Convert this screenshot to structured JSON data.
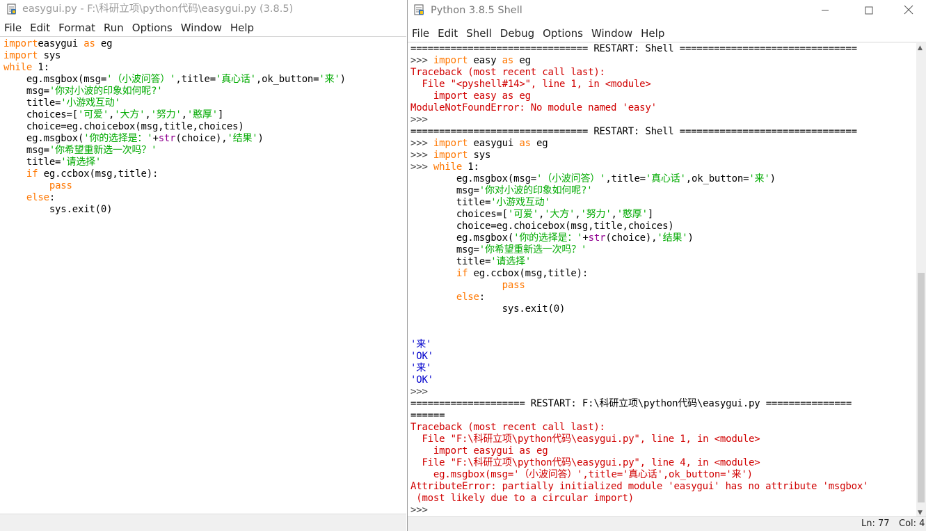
{
  "editor": {
    "title": "easygui.py - F:\\科研立项\\python代码\\easygui.py (3.8.5)",
    "menu": [
      "File",
      "Edit",
      "Format",
      "Run",
      "Options",
      "Window",
      "Help"
    ]
  },
  "shell": {
    "title": "Python 3.8.5 Shell",
    "menu": [
      "File",
      "Edit",
      "Shell",
      "Debug",
      "Options",
      "Window",
      "Help"
    ],
    "status": {
      "line": "Ln: 77",
      "col": "Col: 4"
    }
  },
  "colors": {
    "keyword": "#ff7700",
    "string": "#00aa00",
    "builtin": "#900090",
    "error": "#d00000",
    "output": "#0000cc"
  },
  "icons": {
    "editor_icon": "python-file-icon",
    "shell_icon": "python-shell-icon",
    "minimize": "minimize-icon",
    "maximize": "maximize-icon",
    "close": "close-icon"
  },
  "editor_code": [
    [
      [
        "k",
        "import"
      ],
      [
        "",
        "easygui "
      ],
      [
        "k",
        "as"
      ],
      [
        "",
        " eg"
      ]
    ],
    [
      [
        "k",
        "import"
      ],
      [
        "",
        " sys"
      ]
    ],
    [
      [
        "k",
        "while"
      ],
      [
        "",
        " 1:"
      ]
    ],
    [
      [
        "",
        "    eg.msgbox(msg="
      ],
      [
        "s",
        "'（小波问答）'"
      ],
      [
        "",
        ",title="
      ],
      [
        "s",
        "'真心话'"
      ],
      [
        "",
        ",ok_button="
      ],
      [
        "s",
        "'来'"
      ],
      [
        "",
        ")"
      ]
    ],
    [
      [
        "",
        "    msg="
      ],
      [
        "s",
        "'你对小波的印象如何呢?'"
      ]
    ],
    [
      [
        "",
        "    title="
      ],
      [
        "s",
        "'小游戏互动'"
      ]
    ],
    [
      [
        "",
        "    choices=["
      ],
      [
        "s",
        "'可爱'"
      ],
      [
        "",
        ","
      ],
      [
        "s",
        "'大方'"
      ],
      [
        "",
        ","
      ],
      [
        "s",
        "'努力'"
      ],
      [
        "",
        ","
      ],
      [
        "s",
        "'憨厚'"
      ],
      [
        "",
        "]"
      ]
    ],
    [
      [
        "",
        "    choice=eg.choicebox(msg,title,choices)"
      ]
    ],
    [
      [
        "",
        "    eg.msgbox("
      ],
      [
        "s",
        "'你的选择是：'"
      ],
      [
        "",
        "+"
      ],
      [
        "b",
        "str"
      ],
      [
        "",
        "(choice),"
      ],
      [
        "s",
        "'结果'"
      ],
      [
        "",
        ")"
      ]
    ],
    [
      [
        "",
        "    msg="
      ],
      [
        "s",
        "'你希望重新选一次吗？'"
      ]
    ],
    [
      [
        "",
        "    title="
      ],
      [
        "s",
        "'请选择'"
      ]
    ],
    [
      [
        "",
        "    "
      ],
      [
        "k",
        "if"
      ],
      [
        "",
        " eg.ccbox(msg,title):"
      ]
    ],
    [
      [
        "",
        "        "
      ],
      [
        "k",
        "pass"
      ]
    ],
    [
      [
        "",
        "    "
      ],
      [
        "k",
        "else"
      ],
      [
        "",
        ":"
      ]
    ],
    [
      [
        "",
        "        sys.exit(0)"
      ]
    ]
  ],
  "shell_code": [
    [
      [
        "",
        "=============================== RESTART: Shell ==============================="
      ]
    ],
    [
      [
        "p",
        ">>> "
      ],
      [
        "k",
        "import"
      ],
      [
        "",
        " easy "
      ],
      [
        "k",
        "as"
      ],
      [
        "",
        " eg"
      ]
    ],
    [
      [
        "e",
        "Traceback (most recent call last):"
      ]
    ],
    [
      [
        "e",
        "  File \"<pyshell#14>\", line 1, in <module>"
      ]
    ],
    [
      [
        "e",
        "    import easy as eg"
      ]
    ],
    [
      [
        "e",
        "ModuleNotFoundError: No module named 'easy'"
      ]
    ],
    [
      [
        "p",
        ">>> "
      ]
    ],
    [
      [
        "",
        "=============================== RESTART: Shell ==============================="
      ]
    ],
    [
      [
        "p",
        ">>> "
      ],
      [
        "k",
        "import"
      ],
      [
        "",
        " easygui "
      ],
      [
        "k",
        "as"
      ],
      [
        "",
        " eg"
      ]
    ],
    [
      [
        "p",
        ">>> "
      ],
      [
        "k",
        "import"
      ],
      [
        "",
        " sys"
      ]
    ],
    [
      [
        "p",
        ">>> "
      ],
      [
        "k",
        "while"
      ],
      [
        "",
        " 1:"
      ]
    ],
    [
      [
        "",
        "        eg.msgbox(msg="
      ],
      [
        "s",
        "'（小波问答）'"
      ],
      [
        "",
        ",title="
      ],
      [
        "s",
        "'真心话'"
      ],
      [
        "",
        ",ok_button="
      ],
      [
        "s",
        "'来'"
      ],
      [
        "",
        ")"
      ]
    ],
    [
      [
        "",
        "        msg="
      ],
      [
        "s",
        "'你对小波的印象如何呢?'"
      ]
    ],
    [
      [
        "",
        "        title="
      ],
      [
        "s",
        "'小游戏互动'"
      ]
    ],
    [
      [
        "",
        "        choices=["
      ],
      [
        "s",
        "'可爱'"
      ],
      [
        "",
        ","
      ],
      [
        "s",
        "'大方'"
      ],
      [
        "",
        ","
      ],
      [
        "s",
        "'努力'"
      ],
      [
        "",
        ","
      ],
      [
        "s",
        "'憨厚'"
      ],
      [
        "",
        "]"
      ]
    ],
    [
      [
        "",
        "        choice=eg.choicebox(msg,title,choices)"
      ]
    ],
    [
      [
        "",
        "        eg.msgbox("
      ],
      [
        "s",
        "'你的选择是：'"
      ],
      [
        "",
        "+"
      ],
      [
        "b",
        "str"
      ],
      [
        "",
        "(choice),"
      ],
      [
        "s",
        "'结果'"
      ],
      [
        "",
        ")"
      ]
    ],
    [
      [
        "",
        "        msg="
      ],
      [
        "s",
        "'你希望重新选一次吗？'"
      ]
    ],
    [
      [
        "",
        "        title="
      ],
      [
        "s",
        "'请选择'"
      ]
    ],
    [
      [
        "",
        "        "
      ],
      [
        "k",
        "if"
      ],
      [
        "",
        " eg.ccbox(msg,title):"
      ]
    ],
    [
      [
        "",
        "                "
      ],
      [
        "k",
        "pass"
      ]
    ],
    [
      [
        "",
        "        "
      ],
      [
        "k",
        "else"
      ],
      [
        "",
        ":"
      ]
    ],
    [
      [
        "",
        "                sys.exit(0)"
      ]
    ],
    [
      [
        "",
        ""
      ]
    ],
    [
      [
        "",
        ""
      ]
    ],
    [
      [
        "o",
        "'来'"
      ]
    ],
    [
      [
        "o",
        "'OK'"
      ]
    ],
    [
      [
        "o",
        "'来'"
      ]
    ],
    [
      [
        "o",
        "'OK'"
      ]
    ],
    [
      [
        "p",
        ">>> "
      ]
    ],
    [
      [
        "",
        "==================== RESTART: F:\\科研立项\\python代码\\easygui.py ==============="
      ]
    ],
    [
      [
        "",
        "======"
      ]
    ],
    [
      [
        "e",
        "Traceback (most recent call last):"
      ]
    ],
    [
      [
        "e",
        "  File \"F:\\科研立项\\python代码\\easygui.py\", line 1, in <module>"
      ]
    ],
    [
      [
        "e",
        "    import easygui as eg"
      ]
    ],
    [
      [
        "e",
        "  File \"F:\\科研立项\\python代码\\easygui.py\", line 4, in <module>"
      ]
    ],
    [
      [
        "e",
        "    eg.msgbox(msg='（小波问答）',title='真心话',ok_button='来')"
      ]
    ],
    [
      [
        "e",
        "AttributeError: partially initialized module 'easygui' has no attribute 'msgbox'"
      ]
    ],
    [
      [
        "e",
        " (most likely due to a circular import)"
      ]
    ],
    [
      [
        "p",
        ">>> "
      ]
    ]
  ]
}
